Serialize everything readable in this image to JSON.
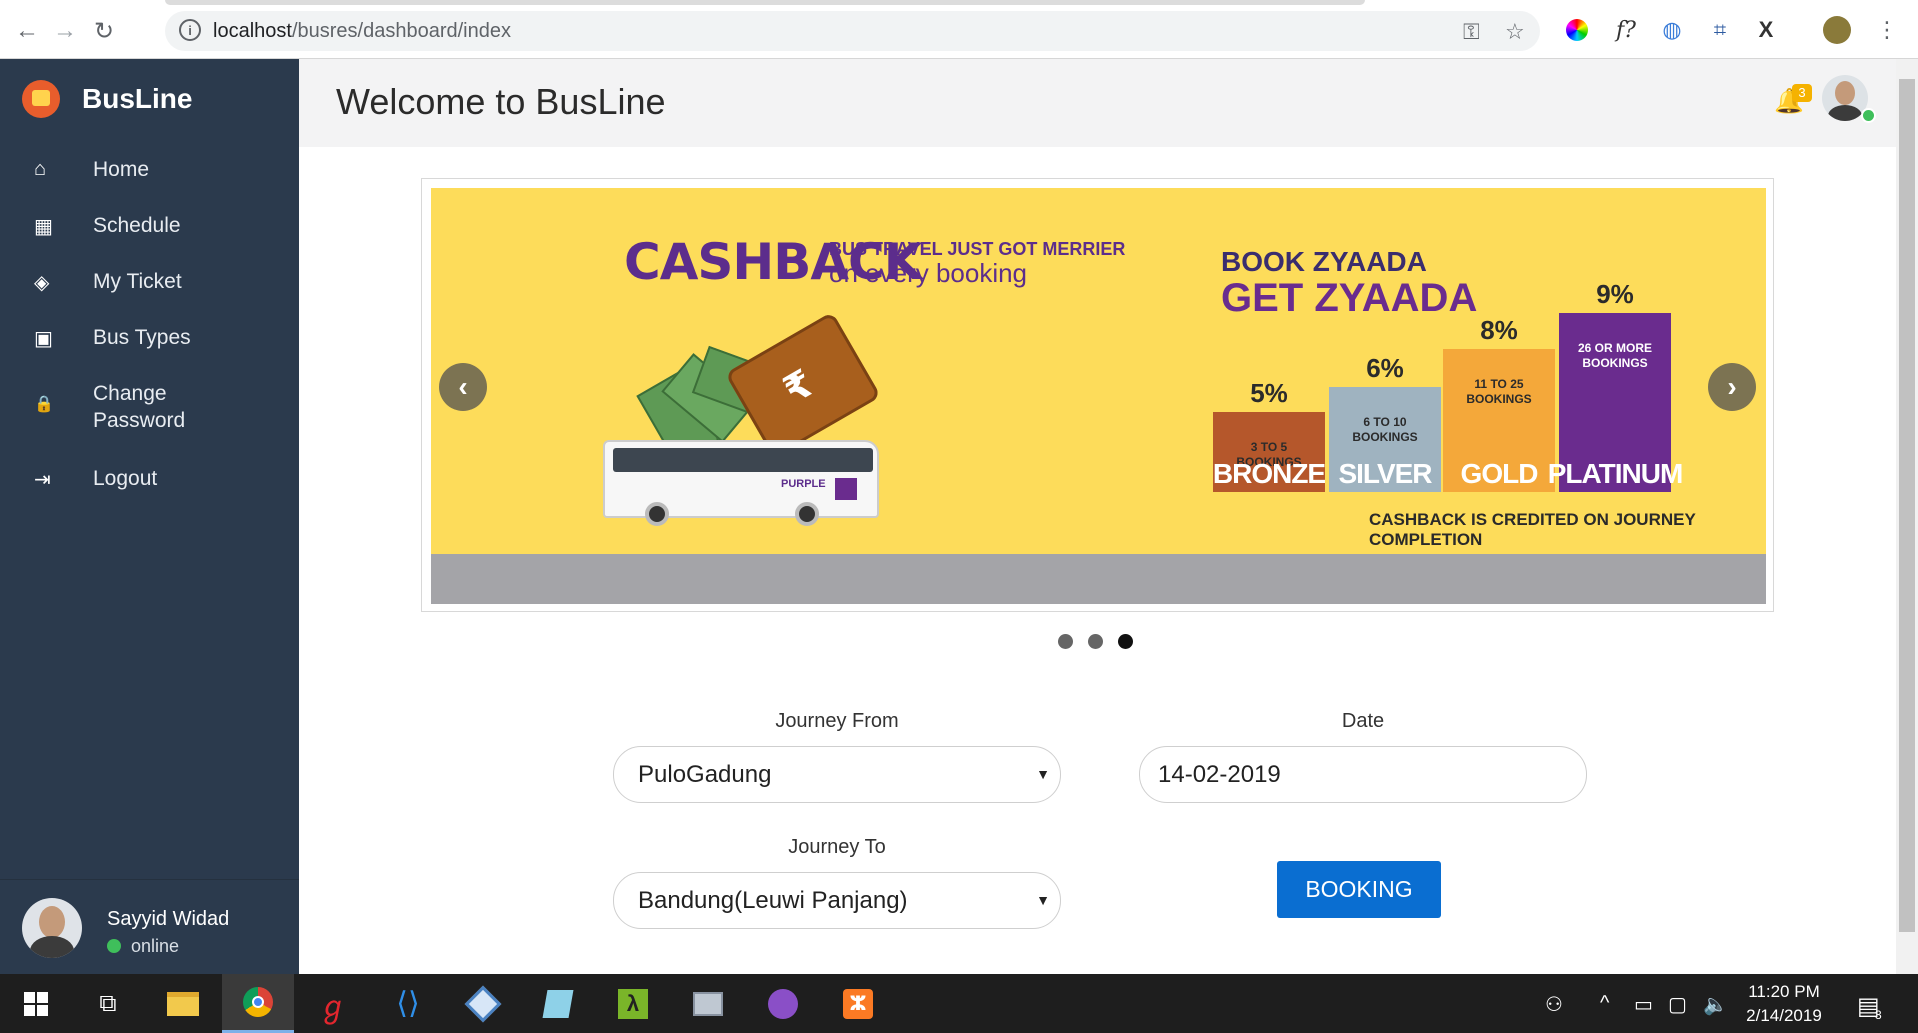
{
  "browser": {
    "url_host": "localhost",
    "url_path": "/busres/dashboard/index",
    "extensions": [
      "color-wheel-icon",
      "font-identifier-icon",
      "globe-icon",
      "crop-icon",
      "x-icon",
      "profile-avatar-icon"
    ]
  },
  "sidebar": {
    "brand": "BusLine",
    "items": [
      {
        "label": "Home",
        "icon": "home-icon",
        "glyph": "⌂"
      },
      {
        "label": "Schedule",
        "icon": "calendar-icon",
        "glyph": "▦"
      },
      {
        "label": "My Ticket",
        "icon": "ticket-icon",
        "glyph": "◈"
      },
      {
        "label": "Bus Types",
        "icon": "bus-icon",
        "glyph": "▣"
      },
      {
        "label": "Change Password",
        "icon": "lock-icon",
        "glyph": "🔒"
      },
      {
        "label": "Logout",
        "icon": "logout-icon",
        "glyph": "⇥"
      }
    ],
    "user": {
      "name": "Sayyid Widad",
      "status": "online"
    }
  },
  "header": {
    "title": "Welcome to BusLine",
    "notification_count": "3"
  },
  "carousel": {
    "cashback_title": "CASHBACK",
    "cashback_line1": "BUS TRAVEL JUST GOT MERRIER",
    "cashback_line2": "on every booking",
    "promo_line1": "BOOK ZYAADA",
    "promo_line2": "GET ZYAADA",
    "tiers": [
      {
        "pct": "5%",
        "range": "3 TO 5 BOOKINGS",
        "name": "BRONZE",
        "color": "#b5572b",
        "height": 0.38
      },
      {
        "pct": "6%",
        "range": "6 TO 10 BOOKINGS",
        "name": "SILVER",
        "color": "#9fb3c0",
        "height": 0.5
      },
      {
        "pct": "8%",
        "range": "11 TO 25 BOOKINGS",
        "name": "GOLD",
        "color": "#f4a83a",
        "height": 0.68
      },
      {
        "pct": "9%",
        "range": "26 OR MORE BOOKINGS",
        "name": "PLATINUM",
        "color": "#6a2c8e",
        "height": 0.85
      }
    ],
    "note": "CASHBACK IS CREDITED ON JOURNEY COMPLETION",
    "bus_brand": "PURPLE",
    "prev_glyph": "‹",
    "next_glyph": "›",
    "slide_count": 3,
    "active_slide": 3
  },
  "form": {
    "journey_from_label": "Journey From",
    "journey_from_value": "PuloGadung",
    "journey_to_label": "Journey To",
    "journey_to_value": "Bandung(Leuwi Panjang)",
    "date_label": "Date",
    "date_value": "14-02-2019",
    "submit_label": "BOOKING"
  },
  "taskbar": {
    "time": "11:20 PM",
    "date": "2/14/2019",
    "notification_count": "3"
  },
  "colors": {
    "sidebar_bg": "#2b3a4d",
    "accent": "#0a6ed1",
    "banner_bg": "#fddc5a"
  }
}
